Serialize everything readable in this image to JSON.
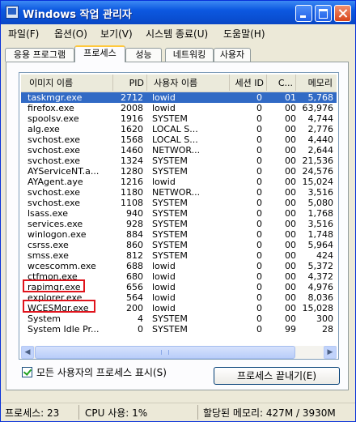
{
  "window": {
    "title": "Windows 작업 관리자"
  },
  "menu": [
    "파일(F)",
    "옵션(O)",
    "보기(V)",
    "시스템 종료(U)",
    "도움말(H)"
  ],
  "tabs": [
    "응용 프로그램",
    "프로세스",
    "성능",
    "네트워킹",
    "사용자"
  ],
  "active_tab": "프로세스",
  "columns": [
    "이미지 이름",
    "PID",
    "사용자 이름",
    "세션 ID",
    "C...",
    "메모리"
  ],
  "processes": [
    {
      "name": "taskmgr.exe",
      "pid": "2712",
      "user": "lowid",
      "session": "0",
      "cpu": "01",
      "mem": "5,768",
      "selected": true
    },
    {
      "name": "firefox.exe",
      "pid": "2008",
      "user": "lowid",
      "session": "0",
      "cpu": "00",
      "mem": "63,976"
    },
    {
      "name": "spoolsv.exe",
      "pid": "1916",
      "user": "SYSTEM",
      "session": "0",
      "cpu": "00",
      "mem": "4,744"
    },
    {
      "name": "alg.exe",
      "pid": "1620",
      "user": "LOCAL S...",
      "session": "0",
      "cpu": "00",
      "mem": "2,776"
    },
    {
      "name": "svchost.exe",
      "pid": "1568",
      "user": "LOCAL S...",
      "session": "0",
      "cpu": "00",
      "mem": "4,440"
    },
    {
      "name": "svchost.exe",
      "pid": "1460",
      "user": "NETWOR...",
      "session": "0",
      "cpu": "00",
      "mem": "2,644"
    },
    {
      "name": "svchost.exe",
      "pid": "1324",
      "user": "SYSTEM",
      "session": "0",
      "cpu": "00",
      "mem": "21,536"
    },
    {
      "name": "AYServiceNT.a...",
      "pid": "1280",
      "user": "SYSTEM",
      "session": "0",
      "cpu": "00",
      "mem": "24,576"
    },
    {
      "name": "AYAgent.aye",
      "pid": "1216",
      "user": "lowid",
      "session": "0",
      "cpu": "00",
      "mem": "15,024"
    },
    {
      "name": "svchost.exe",
      "pid": "1180",
      "user": "NETWOR...",
      "session": "0",
      "cpu": "00",
      "mem": "3,516"
    },
    {
      "name": "svchost.exe",
      "pid": "1108",
      "user": "SYSTEM",
      "session": "0",
      "cpu": "00",
      "mem": "5,080"
    },
    {
      "name": "lsass.exe",
      "pid": "940",
      "user": "SYSTEM",
      "session": "0",
      "cpu": "00",
      "mem": "1,768"
    },
    {
      "name": "services.exe",
      "pid": "928",
      "user": "SYSTEM",
      "session": "0",
      "cpu": "00",
      "mem": "3,516"
    },
    {
      "name": "winlogon.exe",
      "pid": "884",
      "user": "SYSTEM",
      "session": "0",
      "cpu": "00",
      "mem": "1,748"
    },
    {
      "name": "csrss.exe",
      "pid": "860",
      "user": "SYSTEM",
      "session": "0",
      "cpu": "00",
      "mem": "5,964"
    },
    {
      "name": "smss.exe",
      "pid": "812",
      "user": "SYSTEM",
      "session": "0",
      "cpu": "00",
      "mem": "424"
    },
    {
      "name": "wcescomm.exe",
      "pid": "688",
      "user": "lowid",
      "session": "0",
      "cpu": "00",
      "mem": "5,372"
    },
    {
      "name": "ctfmon.exe",
      "pid": "680",
      "user": "lowid",
      "session": "0",
      "cpu": "00",
      "mem": "4,372"
    },
    {
      "name": "rapimgr.exe",
      "pid": "656",
      "user": "lowid",
      "session": "0",
      "cpu": "00",
      "mem": "4,976",
      "highlighted": true
    },
    {
      "name": "explorer.exe",
      "pid": "564",
      "user": "lowid",
      "session": "0",
      "cpu": "00",
      "mem": "8,036"
    },
    {
      "name": "WCESMgr.exe",
      "pid": "200",
      "user": "lowid",
      "session": "0",
      "cpu": "00",
      "mem": "15,028",
      "highlighted": true
    },
    {
      "name": "System",
      "pid": "4",
      "user": "SYSTEM",
      "session": "0",
      "cpu": "00",
      "mem": "300"
    },
    {
      "name": "System Idle Pr...",
      "pid": "0",
      "user": "SYSTEM",
      "session": "0",
      "cpu": "99",
      "mem": "28"
    }
  ],
  "show_all_users": {
    "label": "모든 사용자의 프로세스 표시(S)",
    "checked": true
  },
  "end_process_button": "프로세스 끝내기(E)",
  "status": {
    "processes": "프로세스: 23",
    "cpu": "CPU 사용: 1%",
    "memory": "할당된 메모리: 427M / 3930M"
  },
  "colors": {
    "selection": "#316ac5",
    "highlight_box": "#e0141c",
    "title_bar": "#0a4ed0"
  }
}
